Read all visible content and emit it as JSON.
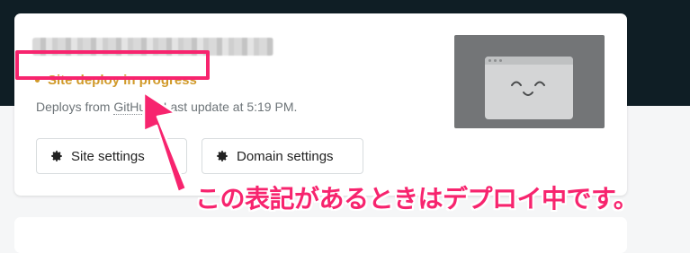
{
  "site_card": {
    "status_text": "Site deploy in progress",
    "deploy_prefix": "Deploys from",
    "deploy_source": "GitHub",
    "deploy_suffix": "Last update at 5:19 PM.",
    "buttons": {
      "site_settings": "Site settings",
      "domain_settings": "Domain settings"
    }
  },
  "annotation": {
    "caption": "この表記があるときはデプロイ中です。"
  },
  "colors": {
    "status": "#d19a2a",
    "annotation": "#f7246e",
    "header_band": "#0f1e25"
  },
  "icons": {
    "button_icon": "gear-icon",
    "preview": "smiling-browser-window"
  }
}
